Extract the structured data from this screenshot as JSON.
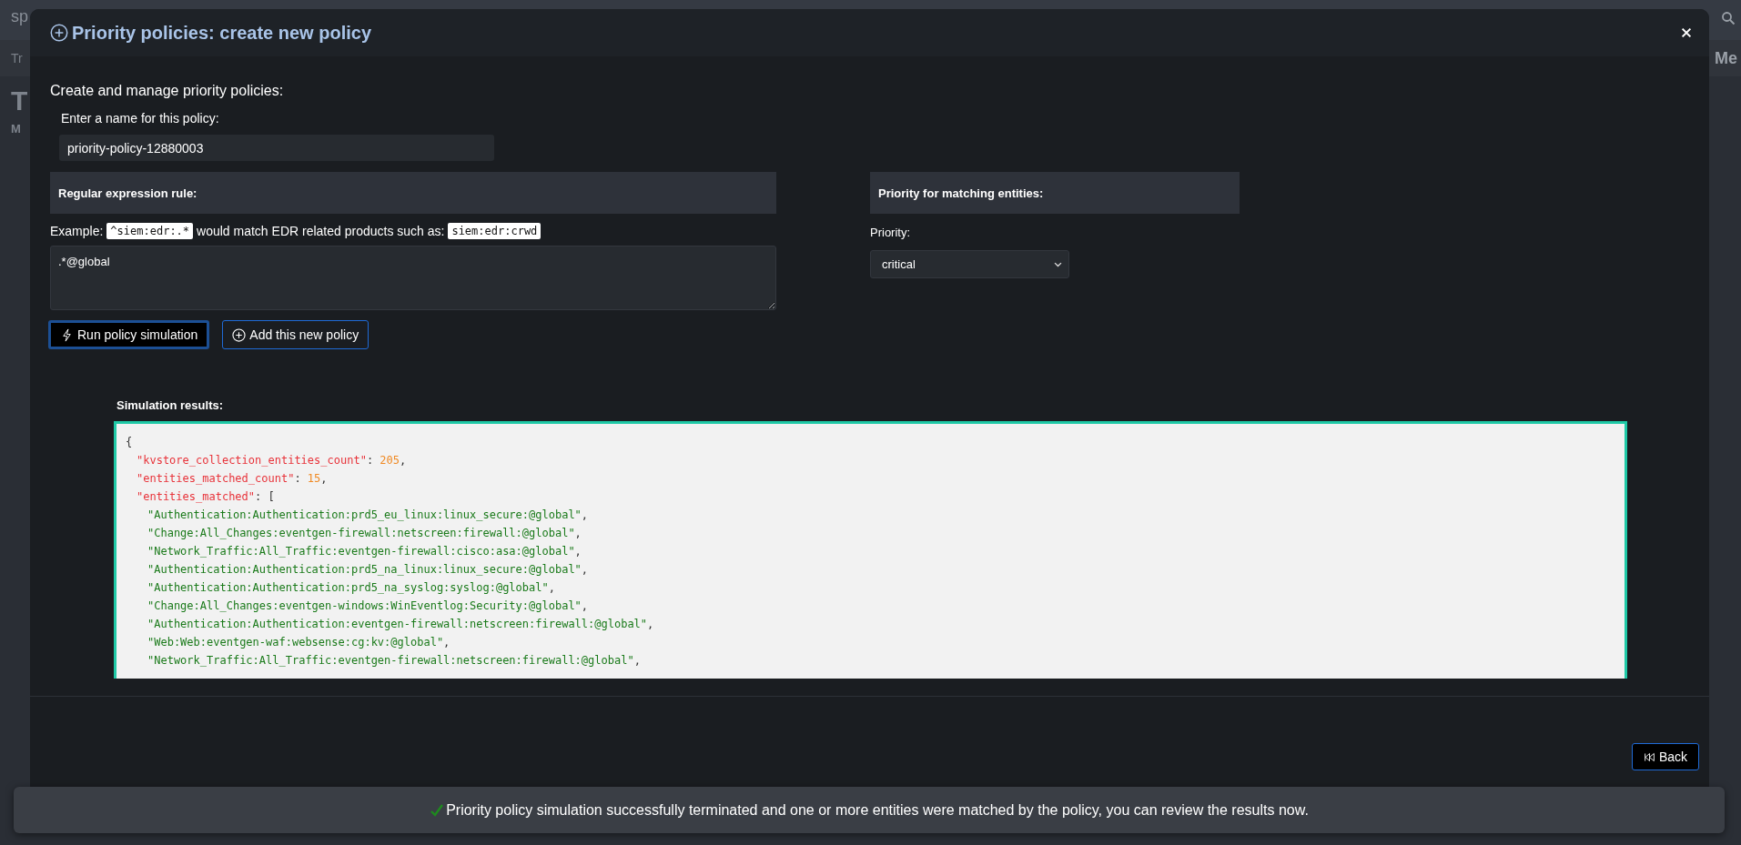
{
  "background_app": {
    "brand": "sp",
    "nav_left": "Tr",
    "nav_right": "Me",
    "heading": "T",
    "subheading": "M"
  },
  "modal": {
    "title": "Priority policies: create new policy",
    "intro": "Create and manage priority policies:",
    "name_label": "Enter a name for this policy:",
    "name_value": "priority-policy-12880003",
    "regex_section": {
      "heading": "Regular expression rule:",
      "example": [
        {
          "kind": "text",
          "s": "Example:"
        },
        {
          "kind": "code",
          "s": "^siem:edr:.*"
        },
        {
          "kind": "text",
          "s": "would match EDR related products such as:"
        },
        {
          "kind": "code",
          "s": "siem:edr:crwd"
        }
      ],
      "value": ".*@global"
    },
    "priority_section": {
      "heading": "Priority for matching entities:",
      "label": "Priority:",
      "value": "critical"
    },
    "buttons": [
      {
        "kind": "run",
        "label": "Run policy simulation",
        "focused": true
      },
      {
        "kind": "add",
        "label": "Add this new policy",
        "focused": false
      }
    ],
    "results_label": "Simulation results:",
    "results_lines": [
      {
        "kind": "root",
        "tokens": [
          {
            "kind": "punct",
            "s": "{"
          }
        ]
      },
      {
        "kind": "field",
        "tokens": [
          {
            "kind": "key",
            "s": "\"kvstore_collection_entities_count\""
          },
          {
            "kind": "punct",
            "s": ": "
          },
          {
            "kind": "num",
            "s": "205"
          },
          {
            "kind": "punct",
            "s": ","
          }
        ]
      },
      {
        "kind": "field",
        "tokens": [
          {
            "kind": "key",
            "s": "\"entities_matched_count\""
          },
          {
            "kind": "punct",
            "s": ": "
          },
          {
            "kind": "num",
            "s": "15"
          },
          {
            "kind": "punct",
            "s": ","
          }
        ]
      },
      {
        "kind": "field",
        "tokens": [
          {
            "kind": "key",
            "s": "\"entities_matched\""
          },
          {
            "kind": "punct",
            "s": ": ["
          }
        ]
      },
      {
        "kind": "entry",
        "tokens": [
          {
            "kind": "str",
            "s": "\"Authentication:Authentication:prd5_eu_linux:linux_secure:@global\""
          },
          {
            "kind": "punct",
            "s": ","
          }
        ]
      },
      {
        "kind": "entry",
        "tokens": [
          {
            "kind": "str",
            "s": "\"Change:All_Changes:eventgen-firewall:netscreen:firewall:@global\""
          },
          {
            "kind": "punct",
            "s": ","
          }
        ]
      },
      {
        "kind": "entry",
        "tokens": [
          {
            "kind": "str",
            "s": "\"Network_Traffic:All_Traffic:eventgen-firewall:cisco:asa:@global\""
          },
          {
            "kind": "punct",
            "s": ","
          }
        ]
      },
      {
        "kind": "entry",
        "tokens": [
          {
            "kind": "str",
            "s": "\"Authentication:Authentication:prd5_na_linux:linux_secure:@global\""
          },
          {
            "kind": "punct",
            "s": ","
          }
        ]
      },
      {
        "kind": "entry",
        "tokens": [
          {
            "kind": "str",
            "s": "\"Authentication:Authentication:prd5_na_syslog:syslog:@global\""
          },
          {
            "kind": "punct",
            "s": ","
          }
        ]
      },
      {
        "kind": "entry",
        "tokens": [
          {
            "kind": "str",
            "s": "\"Change:All_Changes:eventgen-windows:WinEventlog:Security:@global\""
          },
          {
            "kind": "punct",
            "s": ","
          }
        ]
      },
      {
        "kind": "entry",
        "tokens": [
          {
            "kind": "str",
            "s": "\"Authentication:Authentication:eventgen-firewall:netscreen:firewall:@global\""
          },
          {
            "kind": "punct",
            "s": ","
          }
        ]
      },
      {
        "kind": "entry",
        "tokens": [
          {
            "kind": "str",
            "s": "\"Web:Web:eventgen-waf:websense:cg:kv:@global\""
          },
          {
            "kind": "punct",
            "s": ","
          }
        ]
      },
      {
        "kind": "entry",
        "tokens": [
          {
            "kind": "str",
            "s": "\"Network_Traffic:All_Traffic:eventgen-firewall:netscreen:firewall:@global\""
          },
          {
            "kind": "punct",
            "s": ","
          }
        ]
      }
    ],
    "back_button": "Back"
  },
  "toast": {
    "message": "Priority policy simulation successfully terminated and one or more entities were matched by the policy, you can review the results now."
  }
}
